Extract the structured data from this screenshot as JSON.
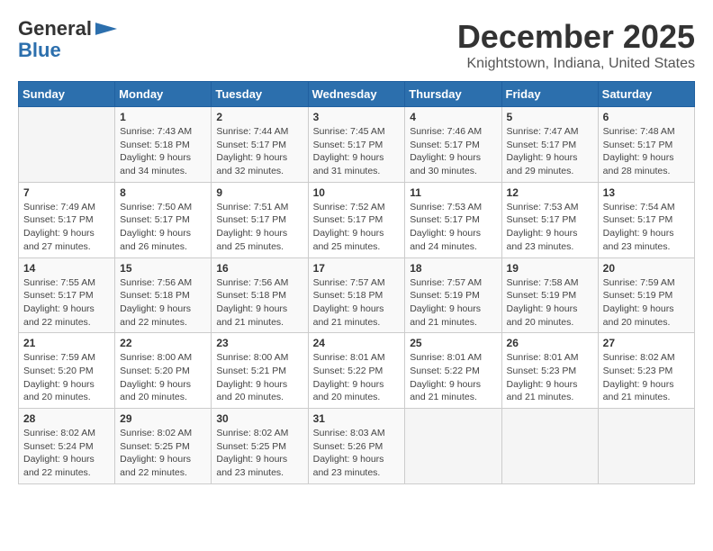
{
  "header": {
    "logo_line1": "General",
    "logo_line2": "Blue",
    "month": "December 2025",
    "location": "Knightstown, Indiana, United States"
  },
  "weekdays": [
    "Sunday",
    "Monday",
    "Tuesday",
    "Wednesday",
    "Thursday",
    "Friday",
    "Saturday"
  ],
  "weeks": [
    [
      {
        "day": "",
        "info": ""
      },
      {
        "day": "1",
        "info": "Sunrise: 7:43 AM\nSunset: 5:18 PM\nDaylight: 9 hours\nand 34 minutes."
      },
      {
        "day": "2",
        "info": "Sunrise: 7:44 AM\nSunset: 5:17 PM\nDaylight: 9 hours\nand 32 minutes."
      },
      {
        "day": "3",
        "info": "Sunrise: 7:45 AM\nSunset: 5:17 PM\nDaylight: 9 hours\nand 31 minutes."
      },
      {
        "day": "4",
        "info": "Sunrise: 7:46 AM\nSunset: 5:17 PM\nDaylight: 9 hours\nand 30 minutes."
      },
      {
        "day": "5",
        "info": "Sunrise: 7:47 AM\nSunset: 5:17 PM\nDaylight: 9 hours\nand 29 minutes."
      },
      {
        "day": "6",
        "info": "Sunrise: 7:48 AM\nSunset: 5:17 PM\nDaylight: 9 hours\nand 28 minutes."
      }
    ],
    [
      {
        "day": "7",
        "info": "Sunrise: 7:49 AM\nSunset: 5:17 PM\nDaylight: 9 hours\nand 27 minutes."
      },
      {
        "day": "8",
        "info": "Sunrise: 7:50 AM\nSunset: 5:17 PM\nDaylight: 9 hours\nand 26 minutes."
      },
      {
        "day": "9",
        "info": "Sunrise: 7:51 AM\nSunset: 5:17 PM\nDaylight: 9 hours\nand 25 minutes."
      },
      {
        "day": "10",
        "info": "Sunrise: 7:52 AM\nSunset: 5:17 PM\nDaylight: 9 hours\nand 25 minutes."
      },
      {
        "day": "11",
        "info": "Sunrise: 7:53 AM\nSunset: 5:17 PM\nDaylight: 9 hours\nand 24 minutes."
      },
      {
        "day": "12",
        "info": "Sunrise: 7:53 AM\nSunset: 5:17 PM\nDaylight: 9 hours\nand 23 minutes."
      },
      {
        "day": "13",
        "info": "Sunrise: 7:54 AM\nSunset: 5:17 PM\nDaylight: 9 hours\nand 23 minutes."
      }
    ],
    [
      {
        "day": "14",
        "info": "Sunrise: 7:55 AM\nSunset: 5:17 PM\nDaylight: 9 hours\nand 22 minutes."
      },
      {
        "day": "15",
        "info": "Sunrise: 7:56 AM\nSunset: 5:18 PM\nDaylight: 9 hours\nand 22 minutes."
      },
      {
        "day": "16",
        "info": "Sunrise: 7:56 AM\nSunset: 5:18 PM\nDaylight: 9 hours\nand 21 minutes."
      },
      {
        "day": "17",
        "info": "Sunrise: 7:57 AM\nSunset: 5:18 PM\nDaylight: 9 hours\nand 21 minutes."
      },
      {
        "day": "18",
        "info": "Sunrise: 7:57 AM\nSunset: 5:19 PM\nDaylight: 9 hours\nand 21 minutes."
      },
      {
        "day": "19",
        "info": "Sunrise: 7:58 AM\nSunset: 5:19 PM\nDaylight: 9 hours\nand 20 minutes."
      },
      {
        "day": "20",
        "info": "Sunrise: 7:59 AM\nSunset: 5:19 PM\nDaylight: 9 hours\nand 20 minutes."
      }
    ],
    [
      {
        "day": "21",
        "info": "Sunrise: 7:59 AM\nSunset: 5:20 PM\nDaylight: 9 hours\nand 20 minutes."
      },
      {
        "day": "22",
        "info": "Sunrise: 8:00 AM\nSunset: 5:20 PM\nDaylight: 9 hours\nand 20 minutes."
      },
      {
        "day": "23",
        "info": "Sunrise: 8:00 AM\nSunset: 5:21 PM\nDaylight: 9 hours\nand 20 minutes."
      },
      {
        "day": "24",
        "info": "Sunrise: 8:01 AM\nSunset: 5:22 PM\nDaylight: 9 hours\nand 20 minutes."
      },
      {
        "day": "25",
        "info": "Sunrise: 8:01 AM\nSunset: 5:22 PM\nDaylight: 9 hours\nand 21 minutes."
      },
      {
        "day": "26",
        "info": "Sunrise: 8:01 AM\nSunset: 5:23 PM\nDaylight: 9 hours\nand 21 minutes."
      },
      {
        "day": "27",
        "info": "Sunrise: 8:02 AM\nSunset: 5:23 PM\nDaylight: 9 hours\nand 21 minutes."
      }
    ],
    [
      {
        "day": "28",
        "info": "Sunrise: 8:02 AM\nSunset: 5:24 PM\nDaylight: 9 hours\nand 22 minutes."
      },
      {
        "day": "29",
        "info": "Sunrise: 8:02 AM\nSunset: 5:25 PM\nDaylight: 9 hours\nand 22 minutes."
      },
      {
        "day": "30",
        "info": "Sunrise: 8:02 AM\nSunset: 5:25 PM\nDaylight: 9 hours\nand 23 minutes."
      },
      {
        "day": "31",
        "info": "Sunrise: 8:03 AM\nSunset: 5:26 PM\nDaylight: 9 hours\nand 23 minutes."
      },
      {
        "day": "",
        "info": ""
      },
      {
        "day": "",
        "info": ""
      },
      {
        "day": "",
        "info": ""
      }
    ]
  ]
}
